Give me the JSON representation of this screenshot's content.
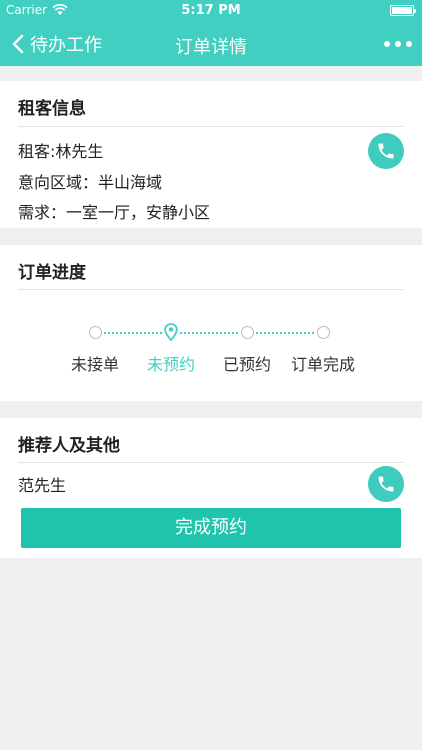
{
  "status_bar": {
    "carrier": "Carrier",
    "time": "5:17 PM"
  },
  "nav": {
    "back_label": "待办工作",
    "title": "订单详情"
  },
  "tenant_card": {
    "title": "租客信息",
    "lines": [
      "租客:林先生",
      "意向区域：半山海域",
      "需求：一室一厅，安静小区"
    ]
  },
  "progress_card": {
    "title": "订单进度",
    "steps": [
      "未接单",
      "未预约",
      "已预约",
      "订单完成"
    ],
    "current_step_index": 1
  },
  "referrer_card": {
    "title": "推荐人及其他",
    "name": "范先生",
    "action_label": "完成预约"
  },
  "colors": {
    "accent": "#41cfc1",
    "button": "#1fc4ac",
    "background": "#efefef"
  },
  "icons": [
    "wifi-icon",
    "battery-icon",
    "chevron-left-icon",
    "more-icon",
    "phone-icon",
    "location-pin-icon"
  ]
}
